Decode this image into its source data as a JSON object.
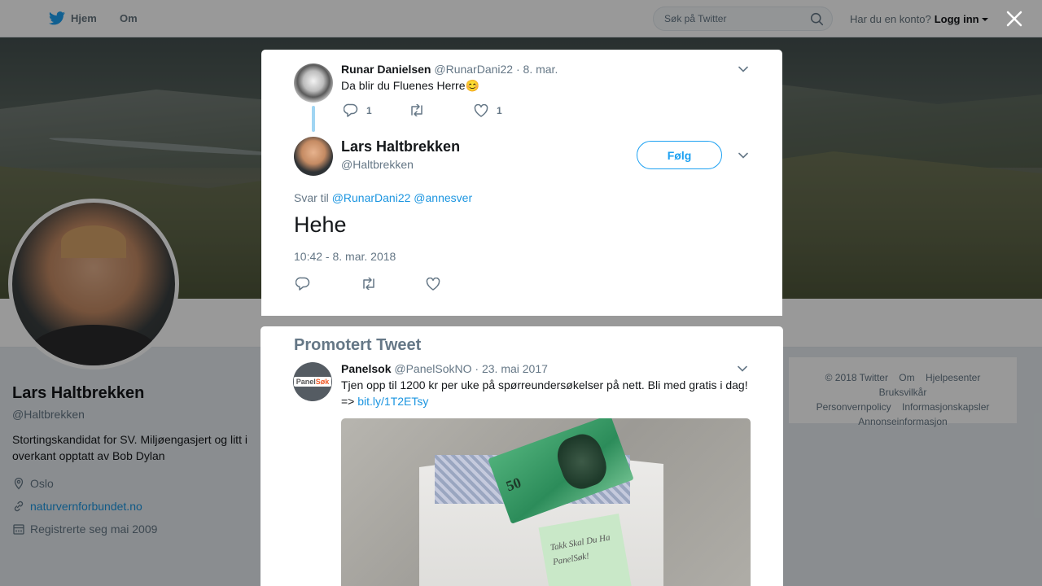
{
  "topbar": {
    "home_label": "Hjem",
    "about_label": "Om",
    "search_placeholder": "Søk på Twitter",
    "account_question": "Har du en konto?",
    "login_label": "Logg inn"
  },
  "profile": {
    "name": "Lars Haltbrekken",
    "handle": "@Haltbrekken",
    "bio": "Stortingskandidat for SV. Miljøengasjert og litt i overkant opptatt av Bob Dylan",
    "location": "Oslo",
    "website": "naturvernforbundet.no",
    "joined": "Registrerte seg mai 2009"
  },
  "footer": {
    "links": [
      "© 2018 Twitter",
      "Om",
      "Hjelpesenter",
      "Bruksvilkår",
      "Personvernpolicy",
      "Informasjonskapsler",
      "Annonseinformasjon"
    ]
  },
  "parent_tweet": {
    "name": "Runar Danielsen",
    "handle": "@RunarDani22",
    "date": "· 8. mar.",
    "text": "Da blir du Fluenes Herre",
    "emoji": "😊",
    "reply_count": "1",
    "like_count": "1"
  },
  "main_tweet": {
    "name": "Lars Haltbrekken",
    "handle": "@Haltbrekken",
    "follow_label": "Følg",
    "reply_prefix": "Svar til",
    "reply_mention_1": "@RunarDani22",
    "reply_mention_2": "@annesver",
    "text": "Hehe",
    "timestamp": "10:42 - 8. mar. 2018"
  },
  "promoted": {
    "section_title": "Promotert Tweet",
    "name": "Panelsok",
    "handle": "@PanelSokNO",
    "date": "· 23. mai 2017",
    "text": "Tjen opp til 1200 kr per uke på spørreundersøkelser på nett. Bli med gratis i dag! =>",
    "link": "bit.ly/1T2ETsy",
    "avatar_logo_a": "Panel",
    "avatar_logo_b": "Søk",
    "image_note": "Takk Skal Du Ha PanelSøk!",
    "bill_value": "50"
  },
  "colors": {
    "accent": "#1da1f2",
    "link": "#1b95e0",
    "muted": "#657786"
  }
}
